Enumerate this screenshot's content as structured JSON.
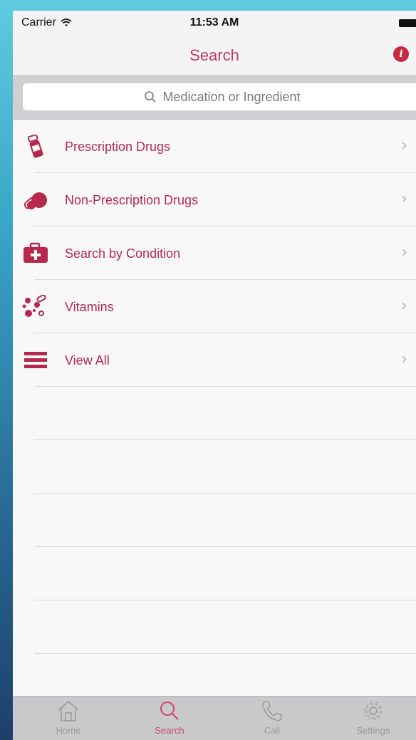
{
  "status_bar": {
    "carrier": "Carrier",
    "time": "11:53 AM"
  },
  "nav": {
    "title": "Search",
    "info_icon": "info-icon"
  },
  "search": {
    "placeholder": "Medication or Ingredient"
  },
  "list": [
    {
      "label": "Prescription Drugs",
      "icon": "pill-bottle-icon"
    },
    {
      "label": "Non-Prescription Drugs",
      "icon": "pills-icon"
    },
    {
      "label": "Search by Condition",
      "icon": "medical-kit-icon"
    },
    {
      "label": "Vitamins",
      "icon": "vitamins-icon"
    },
    {
      "label": "View All",
      "icon": "list-icon"
    }
  ],
  "tabs": [
    {
      "label": "Home",
      "icon": "home-icon",
      "active": false
    },
    {
      "label": "Search",
      "icon": "search-icon",
      "active": true
    },
    {
      "label": "Call",
      "icon": "phone-icon",
      "active": false
    },
    {
      "label": "Settings",
      "icon": "gear-icon",
      "active": false
    }
  ],
  "colors": {
    "accent": "#b6294d",
    "title": "#c03d5f",
    "info": "#c62a43",
    "tab_active": "#d04866"
  }
}
